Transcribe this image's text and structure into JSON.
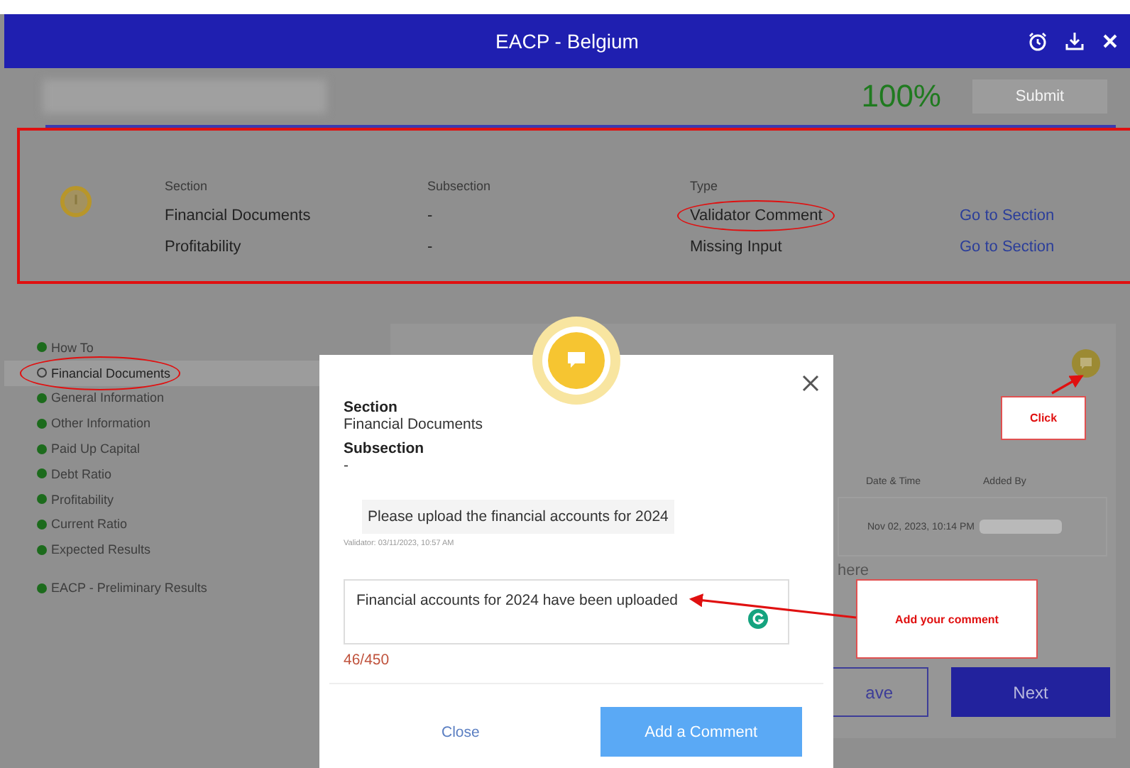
{
  "window": {
    "title": "EACP - Belgium"
  },
  "progress": {
    "percent": "100%",
    "submit": "Submit"
  },
  "issues": {
    "columns": [
      "Section",
      "Subsection",
      "Type"
    ],
    "rows": [
      {
        "section": "Financial Documents",
        "subsection": "-",
        "type": "Validator Comment",
        "link": "Go to Section",
        "circled": true
      },
      {
        "section": "Profitability",
        "subsection": "-",
        "type": "Missing Input",
        "link": "Go to Section",
        "circled": false
      }
    ]
  },
  "sidebar": {
    "items": [
      {
        "label": "How To",
        "selected": false
      },
      {
        "label": "Financial Documents",
        "selected": true
      },
      {
        "label": "General Information",
        "selected": false
      },
      {
        "label": "Other Information",
        "selected": false
      },
      {
        "label": "Paid Up Capital",
        "selected": false
      },
      {
        "label": "Debt Ratio",
        "selected": false
      },
      {
        "label": "Profitability",
        "selected": false
      },
      {
        "label": "Current Ratio",
        "selected": false
      },
      {
        "label": "Expected Results",
        "selected": false
      }
    ],
    "footer_item": {
      "label": "EACP - Preliminary Results"
    }
  },
  "comments": {
    "columns": [
      "Date & Time",
      "Added By"
    ],
    "rows": [
      {
        "date_time": "Nov 02, 2023, 10:14 PM"
      }
    ],
    "hint": "here",
    "save": "ave",
    "next": "Next"
  },
  "modal": {
    "section_label": "Section",
    "section": "Financial Documents",
    "subsection_label": "Subsection",
    "subsection": "-",
    "message": "Please upload the financial accounts for 2024",
    "message_meta": "Validator: 03/11/2023, 10:57 AM",
    "comment": "Financial accounts for 2024 have been uploaded",
    "counter": "46/450",
    "close": "Close",
    "submit": "Add a Comment"
  },
  "callouts": [
    {
      "text": "Click"
    },
    {
      "text": "Add your comment"
    }
  ]
}
